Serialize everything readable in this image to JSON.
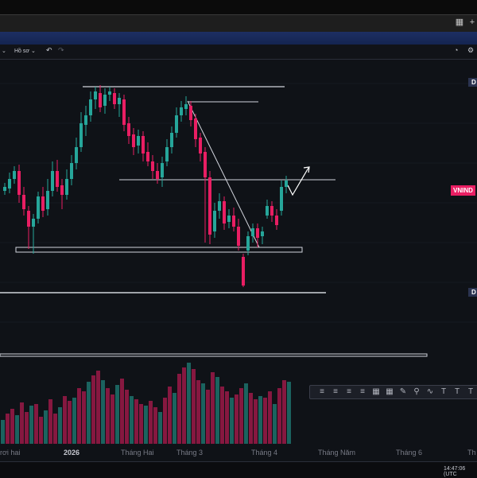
{
  "window": {
    "grid_icon": "grid-icon",
    "plus_icon": "+"
  },
  "toolbar": {
    "chevron": "⌄",
    "profile_label": "Hồ sơ",
    "profile_chevron": "⌄",
    "undo": "↶",
    "redo": "↷",
    "alert_icon": "alarm-icon",
    "settings_icon": "gear-icon"
  },
  "price_axis": {
    "tag_top": "D",
    "tag_bottom": "D",
    "symbol_label": "VNIND"
  },
  "time_axis": {
    "labels": [
      {
        "text": "rơi hai",
        "bold": false
      },
      {
        "text": "2026",
        "bold": true
      },
      {
        "text": "Tháng Hai",
        "bold": false
      },
      {
        "text": "Tháng 3",
        "bold": false
      },
      {
        "text": "Tháng 4",
        "bold": false
      },
      {
        "text": "Tháng Năm",
        "bold": false
      },
      {
        "text": "Tháng 6",
        "bold": false
      },
      {
        "text": "Th",
        "bold": false
      }
    ]
  },
  "footer": {
    "clock": "14:47:06 (UTC"
  },
  "drawing_tools": [
    "align-left-icon",
    "align-center-icon",
    "align-right-icon",
    "justify-icon",
    "grid-icon",
    "table-icon",
    "pen-icon",
    "link-icon",
    "wave-icon",
    "text-icon",
    "text-icon",
    "text-icon"
  ],
  "colors": {
    "up": "#26a69a",
    "down": "#e91e63",
    "background": "#0f1217",
    "accent": "#2962ff"
  }
}
